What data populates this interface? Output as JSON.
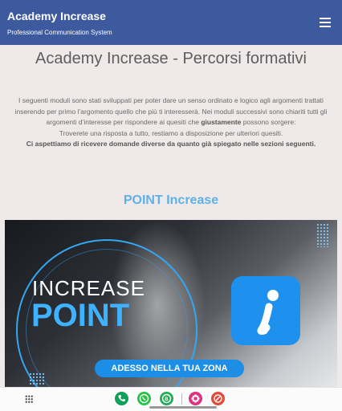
{
  "header": {
    "title": "Academy Increase",
    "subtitle": "Professional Communication System",
    "menu_icon": "hamburger-menu-icon"
  },
  "main": {
    "page_title": "Academy Increase - Percorsi formativi",
    "intro": {
      "line1": "I seguenti moduli sono stati sviluppati per poter dare un senso ordinato e logico agli argomenti trattati inserendo per primo l’argomento quello che più ti interesserà. Nei moduli successivi sono chiariti tutti gli argomenti d’interesse per rispondere ai quesiti che ",
      "emphasis": "giustamente",
      "line1_end": " possono sorgere:",
      "line2": "Troverete una risposta a tutto, restiamo a disposizione per ulteriori quesiti.",
      "line3": "Ci aspettiamo di ricevere domande diverse da quanto già spiegato nelle sezioni seguenti."
    },
    "section_title": "POINT Increase",
    "banner": {
      "word_top": "INCREASE",
      "word_bottom": "POINT",
      "cta": "ADESSO NELLA TUA ZONA",
      "logo_icon": "increase-logo-icon"
    }
  },
  "bottom_bar": {
    "apps_icon": "apps-grid-icon",
    "dock": [
      "phone-icon",
      "whatsapp-icon",
      "whatsapp-business-icon",
      "flower-app-icon",
      "dual-app-icon"
    ],
    "colors": {
      "phone": "#11a05a",
      "whatsapp": "#25c244",
      "whatsapp_business": "#1fae55",
      "flower": "#e0317f",
      "dual": "#e24a3b"
    }
  },
  "colors": {
    "header_bg": "#3d5a9e",
    "section_title": "#5fb0e6",
    "accent_blue": "#1d8ee6",
    "page_bg": "#efe9e9"
  }
}
